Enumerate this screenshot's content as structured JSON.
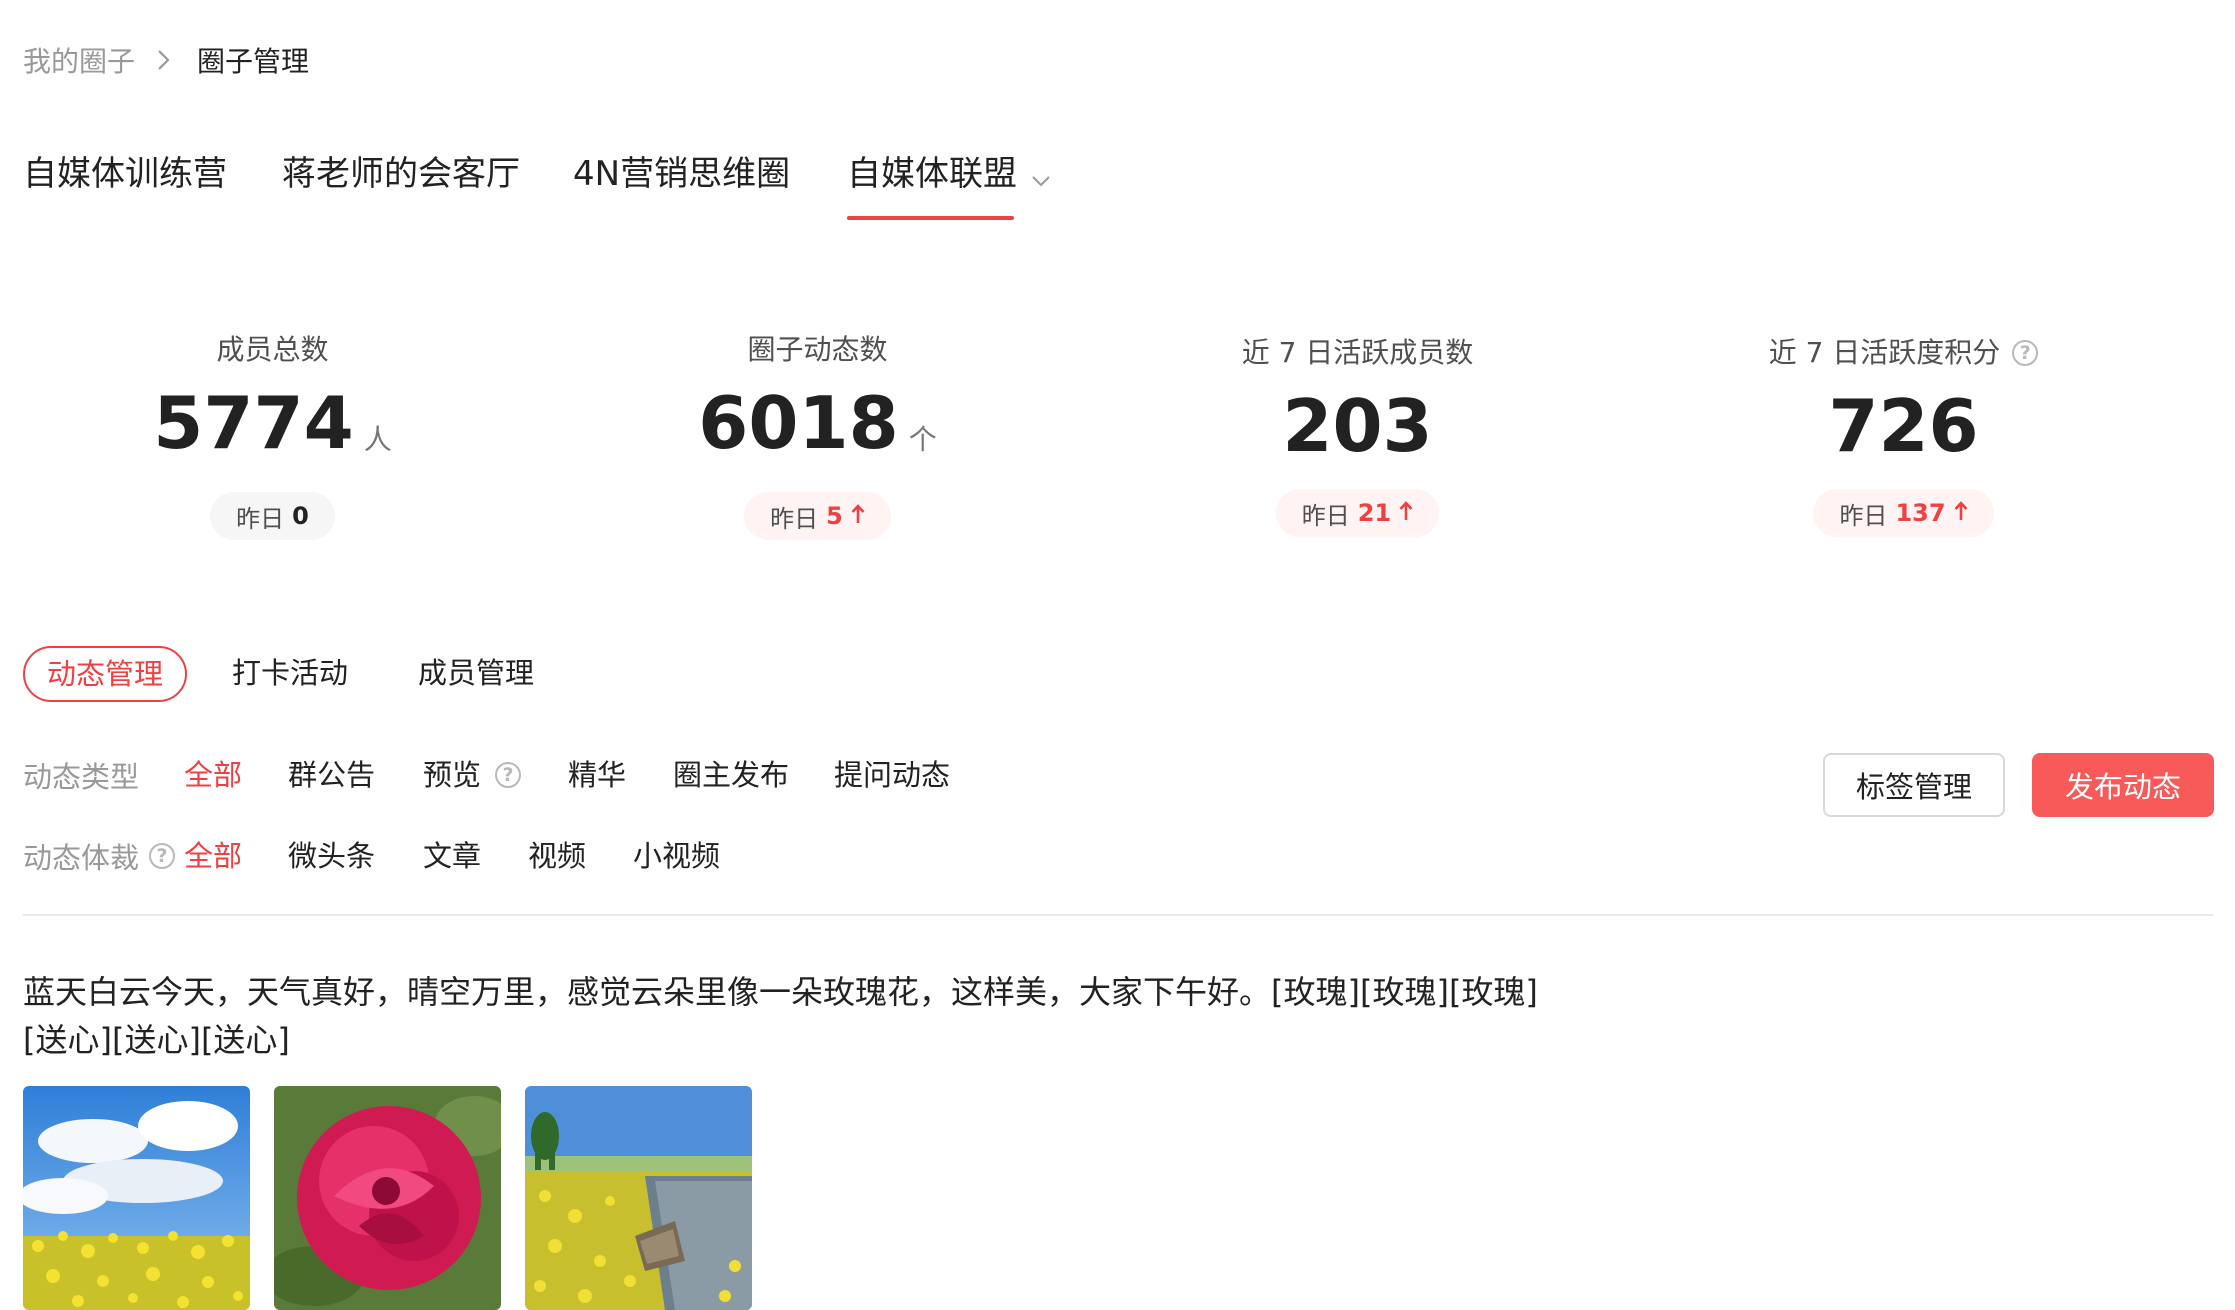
{
  "breadcrumb": {
    "parent": "我的圈子",
    "current": "圈子管理"
  },
  "circle_tabs": [
    {
      "label": "自媒体训练营"
    },
    {
      "label": "蒋老师的会客厅"
    },
    {
      "label": "4N营销思维圈"
    },
    {
      "label": "自媒体联盟",
      "active": true
    }
  ],
  "stats": [
    {
      "label": "成员总数",
      "value": "5774",
      "unit": "人",
      "yesterday_label": "昨日",
      "yesterday_value": "0",
      "trend": "none"
    },
    {
      "label": "圈子动态数",
      "value": "6018",
      "unit": "个",
      "yesterday_label": "昨日",
      "yesterday_value": "5",
      "trend": "up"
    },
    {
      "label": "近 7 日活跃成员数",
      "value": "203",
      "unit": "",
      "yesterday_label": "昨日",
      "yesterday_value": "21",
      "trend": "up"
    },
    {
      "label": "近 7 日活跃度积分",
      "value": "726",
      "unit": "",
      "yesterday_label": "昨日",
      "yesterday_value": "137",
      "trend": "up"
    }
  ],
  "sub_tabs": [
    {
      "label": "动态管理",
      "active": true
    },
    {
      "label": "打卡活动"
    },
    {
      "label": "成员管理"
    }
  ],
  "filters": {
    "type_label": "动态类型",
    "type_options": [
      {
        "label": "全部",
        "selected": true
      },
      {
        "label": "群公告"
      },
      {
        "label": "预览"
      },
      {
        "label": "精华"
      },
      {
        "label": "圈主发布"
      },
      {
        "label": "提问动态"
      }
    ],
    "format_label": "动态体裁",
    "format_options": [
      {
        "label": "全部",
        "selected": true
      },
      {
        "label": "微头条"
      },
      {
        "label": "文章"
      },
      {
        "label": "视频"
      },
      {
        "label": "小视频"
      }
    ]
  },
  "actions": {
    "tag_manage": "标签管理",
    "publish": "发布动态"
  },
  "post": {
    "text_line1": "蓝天白云今天，天气真好，晴空万里，感觉云朵里像一朵玫瑰花，这样美，大家下午好。[玫瑰][玫瑰][玫瑰]",
    "text_line2": "[送心][送心][送心]"
  },
  "colors": {
    "accent": "#f04142",
    "primary_button": "#f85959"
  },
  "icons": [
    "chevron-right-icon",
    "chevron-down-icon",
    "help-icon",
    "arrow-up-icon"
  ]
}
